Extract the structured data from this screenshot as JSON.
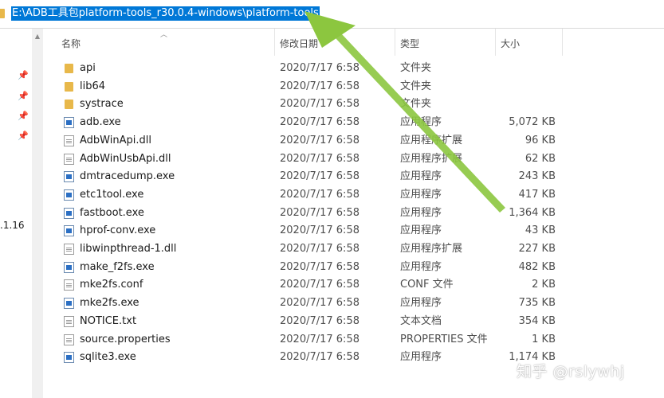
{
  "address_bar": {
    "path": "E:\\ADB工具包platform-tools_r30.0.4-windows\\platform-tools"
  },
  "nav": {
    "partial_label": ".1.16",
    "pin_icon": "pin-icon"
  },
  "columns": {
    "name": "名称",
    "date": "修改日期",
    "type": "类型",
    "size": "大小"
  },
  "files": [
    {
      "name": "api",
      "date": "2020/7/17 6:58",
      "type": "文件夹",
      "size": "",
      "icon": "folder-icon"
    },
    {
      "name": "lib64",
      "date": "2020/7/17 6:58",
      "type": "文件夹",
      "size": "",
      "icon": "folder-icon"
    },
    {
      "name": "systrace",
      "date": "2020/7/17 6:58",
      "type": "文件夹",
      "size": "",
      "icon": "folder-icon"
    },
    {
      "name": "adb.exe",
      "date": "2020/7/17 6:58",
      "type": "应用程序",
      "size": "5,072 KB",
      "icon": "exe-icon"
    },
    {
      "name": "AdbWinApi.dll",
      "date": "2020/7/17 6:58",
      "type": "应用程序扩展",
      "size": "96 KB",
      "icon": "dll-icon"
    },
    {
      "name": "AdbWinUsbApi.dll",
      "date": "2020/7/17 6:58",
      "type": "应用程序扩展",
      "size": "62 KB",
      "icon": "dll-icon"
    },
    {
      "name": "dmtracedump.exe",
      "date": "2020/7/17 6:58",
      "type": "应用程序",
      "size": "243 KB",
      "icon": "exe-icon"
    },
    {
      "name": "etc1tool.exe",
      "date": "2020/7/17 6:58",
      "type": "应用程序",
      "size": "417 KB",
      "icon": "exe-icon"
    },
    {
      "name": "fastboot.exe",
      "date": "2020/7/17 6:58",
      "type": "应用程序",
      "size": "1,364 KB",
      "icon": "exe-icon"
    },
    {
      "name": "hprof-conv.exe",
      "date": "2020/7/17 6:58",
      "type": "应用程序",
      "size": "43 KB",
      "icon": "exe-icon"
    },
    {
      "name": "libwinpthread-1.dll",
      "date": "2020/7/17 6:58",
      "type": "应用程序扩展",
      "size": "227 KB",
      "icon": "dll-icon"
    },
    {
      "name": "make_f2fs.exe",
      "date": "2020/7/17 6:58",
      "type": "应用程序",
      "size": "482 KB",
      "icon": "exe-icon"
    },
    {
      "name": "mke2fs.conf",
      "date": "2020/7/17 6:58",
      "type": "CONF 文件",
      "size": "2 KB",
      "icon": "file-icon"
    },
    {
      "name": "mke2fs.exe",
      "date": "2020/7/17 6:58",
      "type": "应用程序",
      "size": "735 KB",
      "icon": "exe-icon"
    },
    {
      "name": "NOTICE.txt",
      "date": "2020/7/17 6:58",
      "type": "文本文档",
      "size": "354 KB",
      "icon": "text-file-icon"
    },
    {
      "name": "source.properties",
      "date": "2020/7/17 6:58",
      "type": "PROPERTIES 文件",
      "size": "1 KB",
      "icon": "file-icon"
    },
    {
      "name": "sqlite3.exe",
      "date": "2020/7/17 6:58",
      "type": "应用程序",
      "size": "1,174 KB",
      "icon": "exe-icon"
    }
  ],
  "watermark": "知乎 @rslywhj",
  "colors": {
    "selection": "#0078d7",
    "arrow": "#8cc63f",
    "folder": "#e8b84a"
  }
}
